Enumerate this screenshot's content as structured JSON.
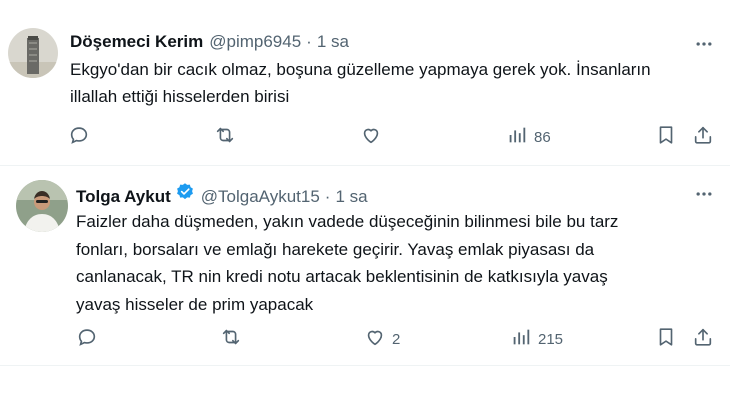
{
  "tweets": [
    {
      "author": {
        "name": "Döşemeci Kerim",
        "handle": "@pimp6945",
        "verified": false
      },
      "separator": "·",
      "time": "1 sa",
      "text_lines": [
        "Ekgyo'dan bir cacık olmaz, boşuna güzelleme yapmaya gerek yok. İnsanların",
        "illallah ettiği hisselerden birisi"
      ],
      "stats": {
        "replies": "",
        "reposts": "",
        "likes": "",
        "views": "86"
      }
    },
    {
      "author": {
        "name": "Tolga Aykut",
        "handle": "@TolgaAykut15",
        "verified": true
      },
      "separator": "·",
      "time": "1 sa",
      "text_lines": [
        "Faizler daha düşmeden, yakın vadede düşeceğinin bilinmesi bile bu tarz",
        "fonları, borsaları ve emlağı harekete geçirir. Yavaş emlak piyasası da",
        "canlanacak, TR nin kredi notu artacak beklentisinin de katkısıyla yavaş",
        "yavaş hisseler de prim yapacak"
      ],
      "stats": {
        "replies": "",
        "reposts": "",
        "likes": "2",
        "views": "215"
      }
    }
  ],
  "icons": {
    "reply": "reply-icon",
    "repost": "repost-icon",
    "like": "heart-icon",
    "views": "views-icon",
    "bookmark": "bookmark-icon",
    "share": "share-icon",
    "more": "more-icon",
    "verified": "verified-badge-icon"
  },
  "colors": {
    "text": "#0f1419",
    "secondary": "#536471",
    "verified": "#1d9bf0",
    "divider": "#eff3f4"
  }
}
